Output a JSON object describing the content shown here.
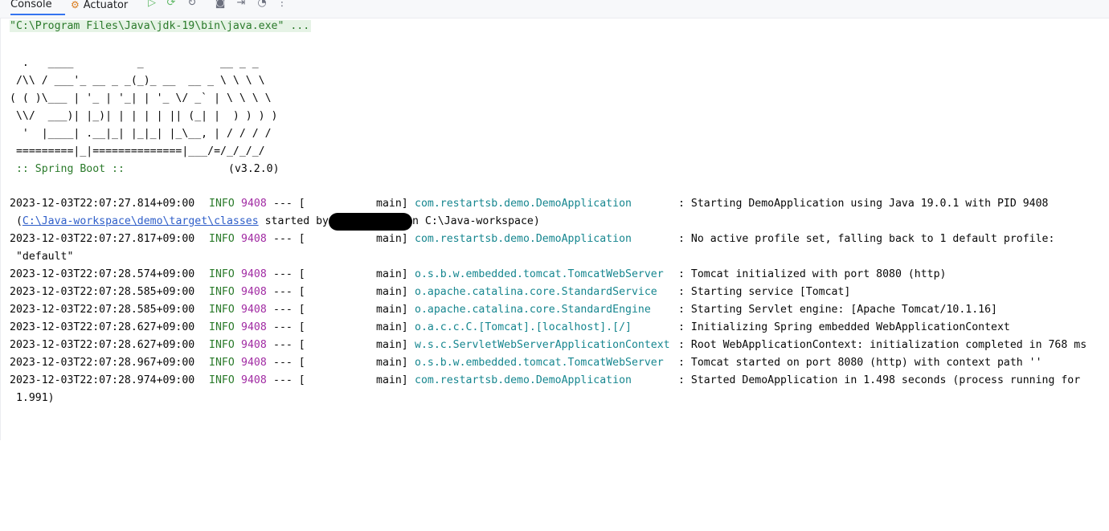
{
  "toolbar": {
    "tabs": [
      {
        "label": "Console",
        "active": true
      },
      {
        "label": "Actuator",
        "icon": "actuator-icon"
      }
    ],
    "icons": [
      "rerun-icon",
      "debug-rerun-icon",
      "screenshot-icon",
      "exit-icon",
      "dashboard-icon",
      "more-icon"
    ]
  },
  "console": {
    "command": "\"C:\\Program Files\\Java\\jdk-19\\bin\\java.exe\" ...",
    "banner": [
      "  .   ____          _            __ _ _",
      " /\\\\ / ___'_ __ _ _(_)_ __  __ _ \\ \\ \\ \\",
      "( ( )\\___ | '_ | '_| | '_ \\/ _` | \\ \\ \\ \\",
      " \\\\/  ___)| |_)| | | | | || (_| |  ) ) ) )",
      "  '  |____| .__|_| |_|_| |_\\__, | / / / /",
      " =========|_|==============|___/=/_/_/_/"
    ],
    "spring_label": " :: Spring Boot ::",
    "spring_version": "(v3.2.0)",
    "logs": [
      {
        "ts": "2023-12-03T22:07:27.814+09:00",
        "level": "INFO",
        "pid": "9408",
        "sep": "--- [",
        "thread": "main]",
        "logger": "com.restartsb.demo.DemoApplication",
        "msg": ": Starting DemoApplication using Java 19.0.1 with PID 9408"
      },
      {
        "ts": "2023-12-03T22:07:27.817+09:00",
        "level": "INFO",
        "pid": "9408",
        "sep": "--- [",
        "thread": "main]",
        "logger": "com.restartsb.demo.DemoApplication",
        "msg": ": No active profile set, falling back to 1 default profile:"
      },
      {
        "ts": "2023-12-03T22:07:28.574+09:00",
        "level": "INFO",
        "pid": "9408",
        "sep": "--- [",
        "thread": "main]",
        "logger": "o.s.b.w.embedded.tomcat.TomcatWebServer",
        "msg": ": Tomcat initialized with port 8080 (http)"
      },
      {
        "ts": "2023-12-03T22:07:28.585+09:00",
        "level": "INFO",
        "pid": "9408",
        "sep": "--- [",
        "thread": "main]",
        "logger": "o.apache.catalina.core.StandardService",
        "msg": ": Starting service [Tomcat]"
      },
      {
        "ts": "2023-12-03T22:07:28.585+09:00",
        "level": "INFO",
        "pid": "9408",
        "sep": "--- [",
        "thread": "main]",
        "logger": "o.apache.catalina.core.StandardEngine",
        "msg": ": Starting Servlet engine: [Apache Tomcat/10.1.16]"
      },
      {
        "ts": "2023-12-03T22:07:28.627+09:00",
        "level": "INFO",
        "pid": "9408",
        "sep": "--- [",
        "thread": "main]",
        "logger": "o.a.c.c.C.[Tomcat].[localhost].[/]",
        "msg": ": Initializing Spring embedded WebApplicationContext"
      },
      {
        "ts": "2023-12-03T22:07:28.627+09:00",
        "level": "INFO",
        "pid": "9408",
        "sep": "--- [",
        "thread": "main]",
        "logger": "w.s.c.ServletWebServerApplicationContext",
        "msg": ": Root WebApplicationContext: initialization completed in 768 ms"
      },
      {
        "ts": "2023-12-03T22:07:28.967+09:00",
        "level": "INFO",
        "pid": "9408",
        "sep": "--- [",
        "thread": "main]",
        "logger": "o.s.b.w.embedded.tomcat.TomcatWebServer",
        "msg": ": Tomcat started on port 8080 (http) with context path ''"
      },
      {
        "ts": "2023-12-03T22:07:28.974+09:00",
        "level": "INFO",
        "pid": "9408",
        "sep": "--- [",
        "thread": "main]",
        "logger": "com.restartsb.demo.DemoApplication",
        "msg": ": Started DemoApplication in 1.498 seconds (process running for"
      }
    ],
    "cont1_prefix": " (",
    "cont1_link": "C:\\Java-workspace\\demo\\target\\classes",
    "cont1_started": " started by",
    "cont1_suffix": "n C:\\Java-workspace)",
    "cont2": " \"default\"",
    "cont3": " 1.991)"
  }
}
